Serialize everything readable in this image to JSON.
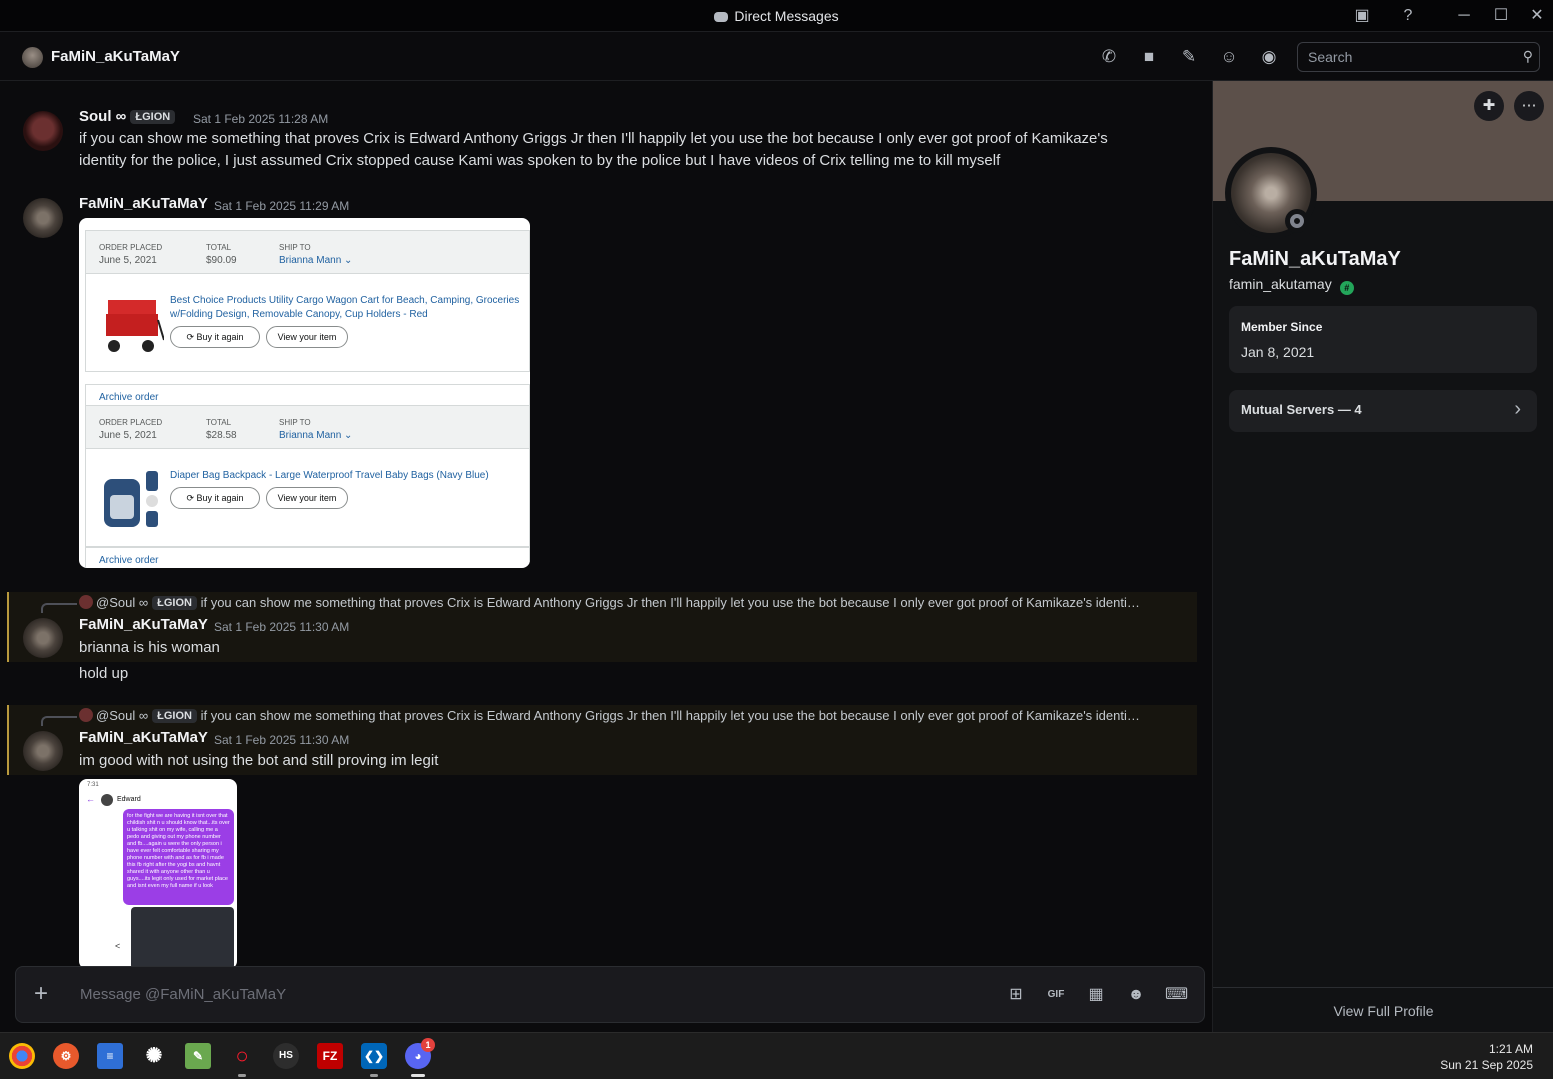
{
  "window": {
    "title": "Direct Messages"
  },
  "header": {
    "name": "FaMiN_aKuTaMaY",
    "search_placeholder": "Search"
  },
  "messages": {
    "m1": {
      "user": "Soul ∞",
      "tag": "ŁGION",
      "time": "Sat 1 Feb 2025 11:28 AM",
      "line1": "if you can show me something that proves Crix is Edward Anthony Griggs Jr then I'll happily let you use the bot because I only ever got proof of Kamikaze's",
      "line2": "identity for the police, I just assumed Crix stopped cause Kami was spoken to by the police but I have videos of Crix telling me to kill myself"
    },
    "m2": {
      "user": "FaMiN_aKuTaMaY",
      "time": "Sat 1 Feb 2025 11:29 AM"
    },
    "m3": {
      "reply_user": "@Soul ∞",
      "reply_tag": "ŁGION",
      "reply_text": "if you can show me something that proves Crix is Edward Anthony Griggs Jr then I'll happily let you use the bot because I only ever got proof of Kamikaze's identi…",
      "user": "FaMiN_aKuTaMaY",
      "time": "Sat 1 Feb 2025 11:30 AM",
      "text": "brianna is his woman"
    },
    "m3b": {
      "text": "hold up"
    },
    "m4": {
      "reply_user": "@Soul ∞",
      "reply_tag": "ŁGION",
      "reply_text": "if you can show me something that proves Crix is Edward Anthony Griggs Jr then I'll happily let you use the bot because I only ever got proof of Kamikaze's identi…",
      "user": "FaMiN_aKuTaMaY",
      "time": "Sat 1 Feb 2025 11:30 AM",
      "text": "im good with not using the bot and still proving im legit"
    }
  },
  "orders": [
    {
      "placed_label": "ORDER PLACED",
      "placed": "June 5, 2021",
      "total_label": "TOTAL",
      "total": "$90.09",
      "ship_label": "SHIP TO",
      "ship": "Brianna Mann",
      "title": "Best Choice Products Utility Cargo Wagon Cart for Beach, Camping, Groceries w/Folding Design, Removable Canopy, Cup Holders - Red",
      "buy": "Buy it again",
      "view": "View your item",
      "archive": "Archive order"
    },
    {
      "placed_label": "ORDER PLACED",
      "placed": "June 5, 2021",
      "total_label": "TOTAL",
      "total": "$28.58",
      "ship_label": "SHIP TO",
      "ship": "Brianna Mann",
      "title": "Diaper Bag Backpack - Large Waterproof Travel Baby Bags (Navy Blue)",
      "buy": "Buy it again",
      "view": "View your item",
      "archive": "Archive order"
    }
  ],
  "phone_shot": {
    "status": "7:31",
    "contact": "Edward",
    "bubble": "for the fight we are having it isnt over that childish shit n u should know that...its over u talking shit on my wife, calling me a pedo and giving out my phone number and fb....again u were the only person i have ever felt comfortable sharing my phone number with and as for fb i made this fb right after the yogi bs and havnt shared it with anyone other than u guys....its legit only used for market place and isnt even my full name if u look"
  },
  "composer": {
    "placeholder": "Message @FaMiN_aKuTaMaY"
  },
  "profile": {
    "display_name": "FaMiN_aKuTaMaY",
    "username": "famin_akutamay",
    "member_since_label": "Member Since",
    "member_since": "Jan 8, 2021",
    "mutual_servers": "Mutual Servers — 4",
    "view_full": "View Full Profile"
  },
  "taskbar": {
    "time": "1:21 AM",
    "date": "Sun 21 Sep 2025",
    "discord_badge": "1"
  }
}
